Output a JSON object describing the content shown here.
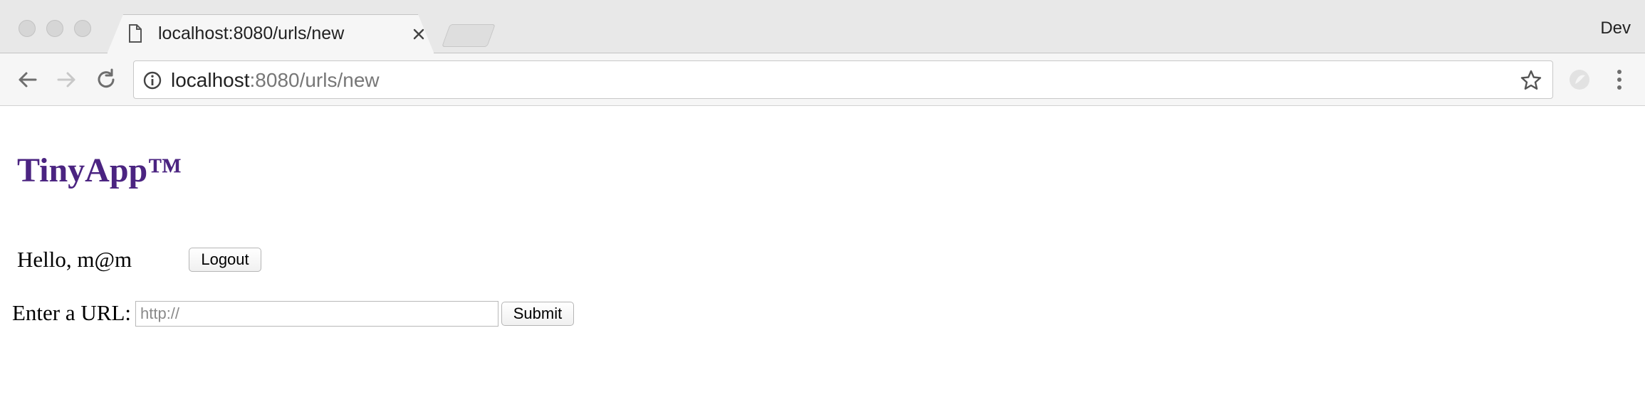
{
  "browser": {
    "tab": {
      "title": "localhost:8080/urls/new",
      "icon": "page-icon"
    },
    "profile": "Dev",
    "address": {
      "host": "localhost",
      "rest": ":8080/urls/new"
    }
  },
  "app": {
    "title": "TinyApp™",
    "title_color": "#4b2481",
    "greeting": "Hello, m@m",
    "logout_label": "Logout",
    "url_label": "Enter a URL:",
    "url_placeholder": "http://",
    "url_value": "",
    "submit_label": "Submit"
  }
}
